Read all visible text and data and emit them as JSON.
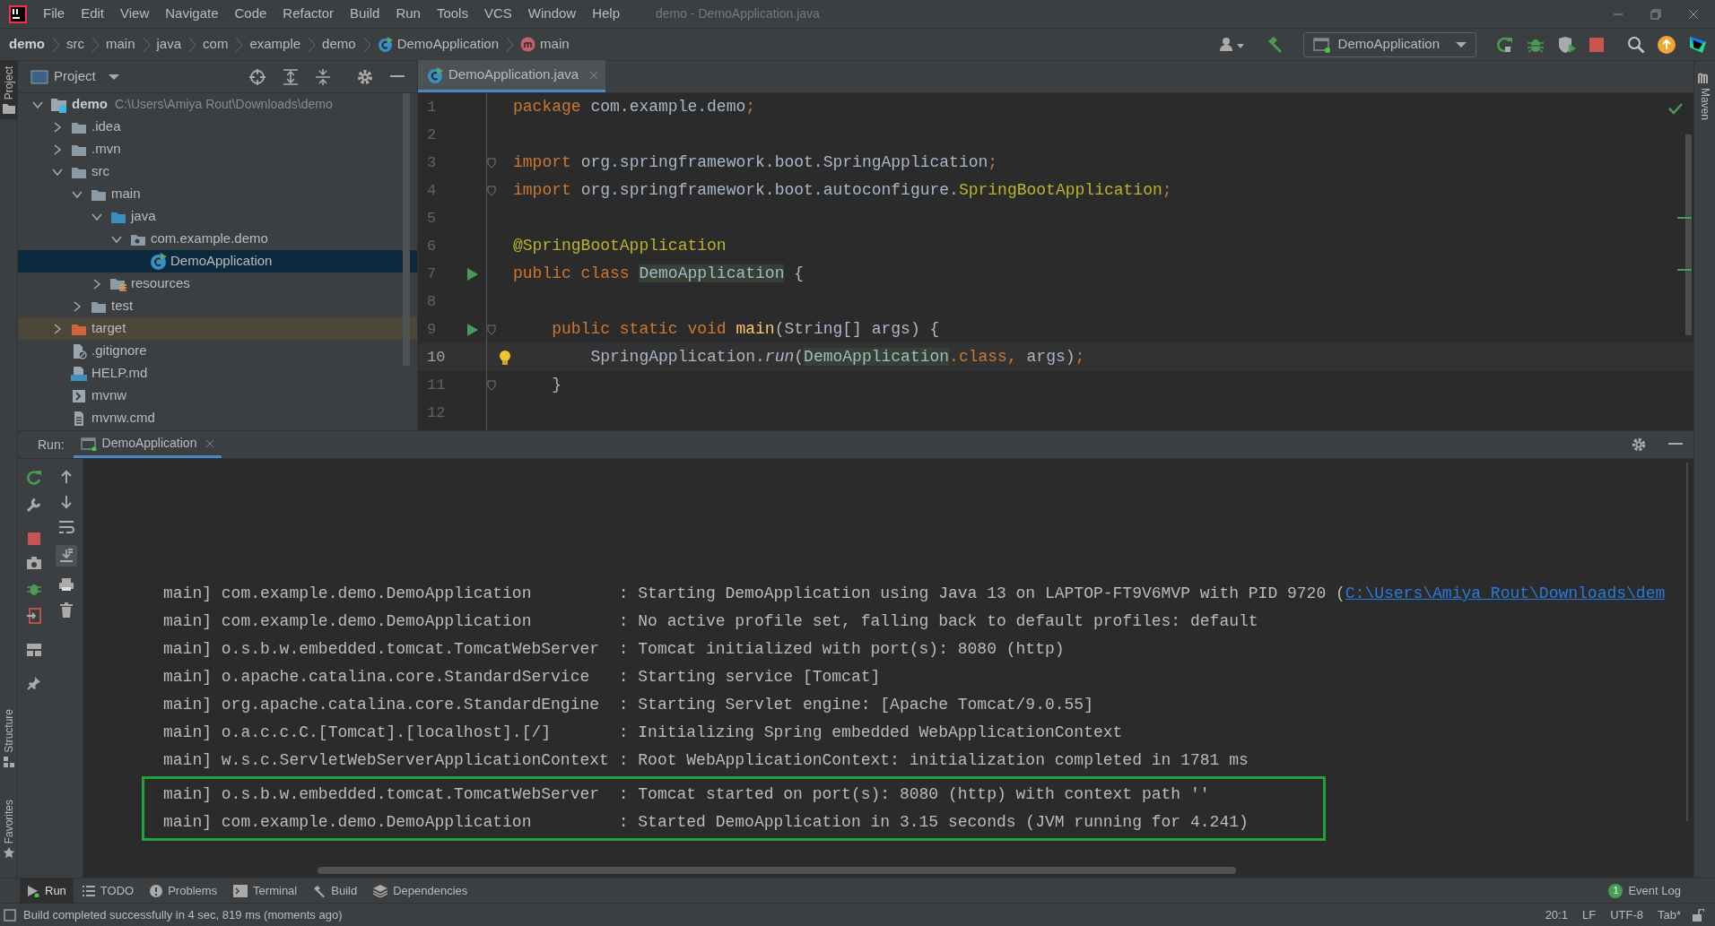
{
  "menu": [
    {
      "label": "File"
    },
    {
      "label": "Edit"
    },
    {
      "label": "View"
    },
    {
      "label": "Navigate"
    },
    {
      "label": "Code"
    },
    {
      "label": "Refactor"
    },
    {
      "label": "Build"
    },
    {
      "label": "Run"
    },
    {
      "label": "Tools"
    },
    {
      "label": "VCS"
    },
    {
      "label": "Window"
    },
    {
      "label": "Help"
    }
  ],
  "window_title": "demo - DemoApplication.java",
  "breadcrumbs": [
    {
      "label": "demo",
      "kind": "project"
    },
    {
      "label": "src",
      "kind": "dir"
    },
    {
      "label": "main",
      "kind": "dir"
    },
    {
      "label": "java",
      "kind": "dir"
    },
    {
      "label": "com",
      "kind": "dir"
    },
    {
      "label": "example",
      "kind": "dir"
    },
    {
      "label": "demo",
      "kind": "dir"
    },
    {
      "label": "DemoApplication",
      "kind": "class"
    },
    {
      "label": "main",
      "kind": "method"
    }
  ],
  "run_config": "DemoApplication",
  "left_stripe": {
    "top": [
      {
        "label": "Project",
        "selected": true
      }
    ],
    "bottom": [
      {
        "label": "Structure",
        "selected": false
      },
      {
        "label": "Favorites",
        "selected": false
      }
    ]
  },
  "right_stripe": [
    {
      "label": "Maven"
    }
  ],
  "project_panel": {
    "title": "Project",
    "tree": [
      {
        "label": "demo",
        "path": "C:\\Users\\Amiya Rout\\Downloads\\demo",
        "kind": "project",
        "expanded": true,
        "selected": false,
        "children": [
          {
            "label": ".idea",
            "kind": "folder",
            "expanded": false,
            "selected": false
          },
          {
            "label": ".mvn",
            "kind": "folder",
            "expanded": false,
            "selected": false
          },
          {
            "label": "src",
            "kind": "folder",
            "expanded": true,
            "selected": false,
            "children": [
              {
                "label": "main",
                "kind": "folder",
                "expanded": true,
                "selected": false,
                "children": [
                  {
                    "label": "java",
                    "kind": "source",
                    "expanded": true,
                    "selected": false,
                    "children": [
                      {
                        "label": "com.example.demo",
                        "kind": "package",
                        "expanded": true,
                        "selected": false,
                        "children": [
                          {
                            "label": "DemoApplication",
                            "kind": "class",
                            "selected": true
                          }
                        ]
                      }
                    ]
                  },
                  {
                    "label": "resources",
                    "kind": "resources",
                    "expanded": false,
                    "selected": false
                  }
                ]
              },
              {
                "label": "test",
                "kind": "folder",
                "expanded": false,
                "selected": false
              }
            ]
          },
          {
            "label": "target",
            "kind": "excluded",
            "expanded": false,
            "selected": false
          },
          {
            "label": ".gitignore",
            "kind": "ignore",
            "selected": false
          },
          {
            "label": "HELP.md",
            "kind": "markdown",
            "selected": false
          },
          {
            "label": "mvnw",
            "kind": "script",
            "selected": false
          },
          {
            "label": "mvnw.cmd",
            "kind": "text",
            "selected": false
          }
        ]
      }
    ]
  },
  "editor": {
    "tab": {
      "label": "DemoApplication.java",
      "selected": true
    },
    "lines": [
      {
        "number": "1",
        "kind": "plain",
        "fold": false,
        "current": false,
        "tokens": [
          {
            "text": "package ",
            "kind": "kw"
          },
          {
            "text": "com.example.demo",
            "kind": "plain"
          },
          {
            "text": ";",
            "kind": "kw"
          }
        ]
      },
      {
        "number": "2",
        "kind": "plain",
        "fold": false,
        "current": false
      },
      {
        "number": "3",
        "kind": "plain",
        "fold": true,
        "current": false,
        "tokens": [
          {
            "text": "import ",
            "kind": "kw"
          },
          {
            "text": "org.springframework.boot.SpringApplication",
            "kind": "plain"
          },
          {
            "text": ";",
            "kind": "kw"
          }
        ]
      },
      {
        "number": "4",
        "kind": "plain",
        "fold": true,
        "current": false,
        "tokens": [
          {
            "text": "import ",
            "kind": "kw"
          },
          {
            "text": "org.springframework.boot.autoconfigure.",
            "kind": "plain"
          },
          {
            "text": "SpringBootApplication",
            "kind": "ann"
          },
          {
            "text": ";",
            "kind": "kw"
          }
        ]
      },
      {
        "number": "5",
        "kind": "plain",
        "fold": false,
        "current": false
      },
      {
        "number": "6",
        "kind": "plain",
        "fold": false,
        "current": false,
        "tokens": [
          {
            "text": "@SpringBootApplication",
            "kind": "ann"
          }
        ]
      },
      {
        "number": "7",
        "kind": "run",
        "fold": false,
        "current": false,
        "tokens": [
          {
            "text": "public class ",
            "kind": "kw"
          },
          {
            "text": "DemoApplication",
            "kind": "ref"
          },
          {
            "text": " {",
            "kind": "plain"
          }
        ]
      },
      {
        "number": "8",
        "kind": "plain",
        "fold": false,
        "current": false
      },
      {
        "number": "9",
        "kind": "run",
        "fold": true,
        "current": false,
        "tokens": [
          {
            "text": "    public static void ",
            "kind": "kw"
          },
          {
            "text": "main",
            "kind": "fn"
          },
          {
            "text": "(String[] args) {",
            "kind": "plain"
          }
        ]
      },
      {
        "number": "10",
        "kind": "bulb",
        "fold": false,
        "current": true,
        "tokens": [
          {
            "text": "        SpringApplication.",
            "kind": "plain"
          },
          {
            "text": "run",
            "kind": "italic"
          },
          {
            "text": "(",
            "kind": "plain"
          },
          {
            "text": "DemoApplication",
            "kind": "ref"
          },
          {
            "text": ".class, ",
            "kind": "kw"
          },
          {
            "text": "args)",
            "kind": "plain"
          },
          {
            "text": ";",
            "kind": "kw"
          }
        ]
      },
      {
        "number": "11",
        "kind": "plain",
        "fold": true,
        "current": false,
        "tokens": [
          {
            "text": "    }",
            "kind": "plain"
          }
        ]
      },
      {
        "number": "12",
        "kind": "plain",
        "fold": false,
        "current": false
      }
    ]
  },
  "run_panel": {
    "label": "Run:",
    "tab": {
      "label": "DemoApplication",
      "selected": true
    },
    "log": [
      {
        "source": "main] com.example.demo.DemoApplication",
        "message": ": Starting DemoApplication using Java 13 on LAPTOP-FT9V6MVP with PID 9720 (",
        "link": "C:\\Users\\Amiya Rout\\Downloads\\dem",
        "highlighted": false
      },
      {
        "source": "main] com.example.demo.DemoApplication",
        "message": ": No active profile set, falling back to default profiles: default",
        "highlighted": false
      },
      {
        "source": "main] o.s.b.w.embedded.tomcat.TomcatWebServer",
        "message": ": Tomcat initialized with port(s): 8080 (http)",
        "highlighted": false
      },
      {
        "source": "main] o.apache.catalina.core.StandardService",
        "message": ": Starting service [Tomcat]",
        "highlighted": false
      },
      {
        "source": "main] org.apache.catalina.core.StandardEngine",
        "message": ": Starting Servlet engine: [Apache Tomcat/9.0.55]",
        "highlighted": false
      },
      {
        "source": "main] o.a.c.c.C.[Tomcat].[localhost].[/]",
        "message": ": Initializing Spring embedded WebApplicationContext",
        "highlighted": false
      },
      {
        "source": "main] w.s.c.ServletWebServerApplicationContext",
        "message": ": Root WebApplicationContext: initialization completed in 1781 ms",
        "highlighted": false
      },
      {
        "source": "main] o.s.b.w.embedded.tomcat.TomcatWebServer",
        "message": ": Tomcat started on port(s): 8080 (http) with context path ''",
        "highlighted": true
      },
      {
        "source": "main] com.example.demo.DemoApplication",
        "message": ": Started DemoApplication in 3.15 seconds (JVM running for 4.241)",
        "highlighted": true
      }
    ]
  },
  "tool_tabs": [
    {
      "label": "Run",
      "kind": "run",
      "selected": true
    },
    {
      "label": "TODO",
      "kind": "list",
      "selected": false
    },
    {
      "label": "Problems",
      "kind": "problems",
      "selected": false
    },
    {
      "label": "Terminal",
      "kind": "terminal",
      "selected": false
    },
    {
      "label": "Build",
      "kind": "build",
      "selected": false
    },
    {
      "label": "Dependencies",
      "kind": "layers",
      "selected": false
    }
  ],
  "event_log": {
    "label": "Event Log",
    "count": "1"
  },
  "status_bar": {
    "message": "Build completed successfully in 4 sec, 819 ms (moments ago)",
    "items": [
      {
        "label": "20:1"
      },
      {
        "label": "LF"
      },
      {
        "label": "UTF-8"
      },
      {
        "label": "Tab*"
      }
    ]
  }
}
